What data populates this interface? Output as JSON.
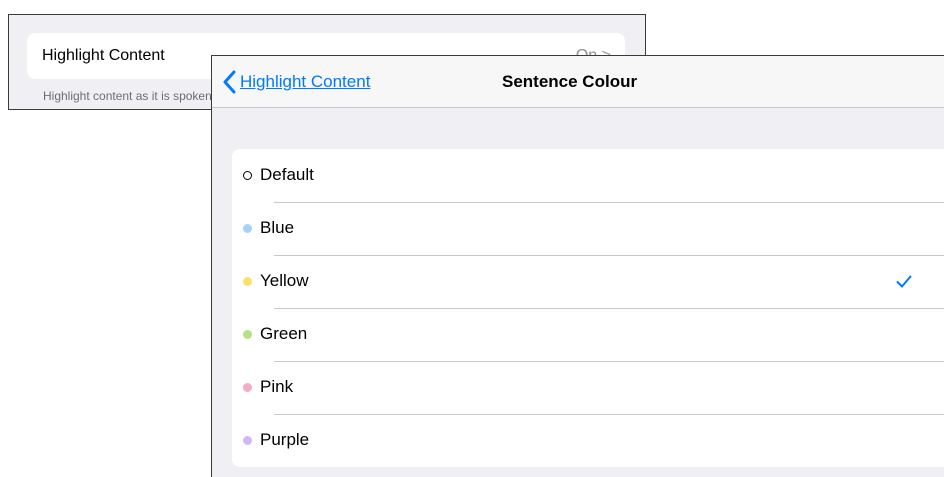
{
  "background_screen": {
    "row_label": "Highlight Content",
    "row_value": "On >",
    "footer": "Highlight content as it is spoken"
  },
  "nav": {
    "back_label": "Highlight Content",
    "back_icon": "chevron-left-icon",
    "title": "Sentence Colour"
  },
  "accent_color": "#007aff",
  "options": [
    {
      "label": "Default",
      "color": "outline",
      "selected": false
    },
    {
      "label": "Blue",
      "color": "#a7d1fa",
      "selected": false
    },
    {
      "label": "Yellow",
      "color": "#fbe067",
      "selected": true
    },
    {
      "label": "Green",
      "color": "#b3e283",
      "selected": false
    },
    {
      "label": "Pink",
      "color": "#f6abc5",
      "selected": false
    },
    {
      "label": "Purple",
      "color": "#d2b6f7",
      "selected": false
    }
  ],
  "selected_icon": "checkmark-icon"
}
